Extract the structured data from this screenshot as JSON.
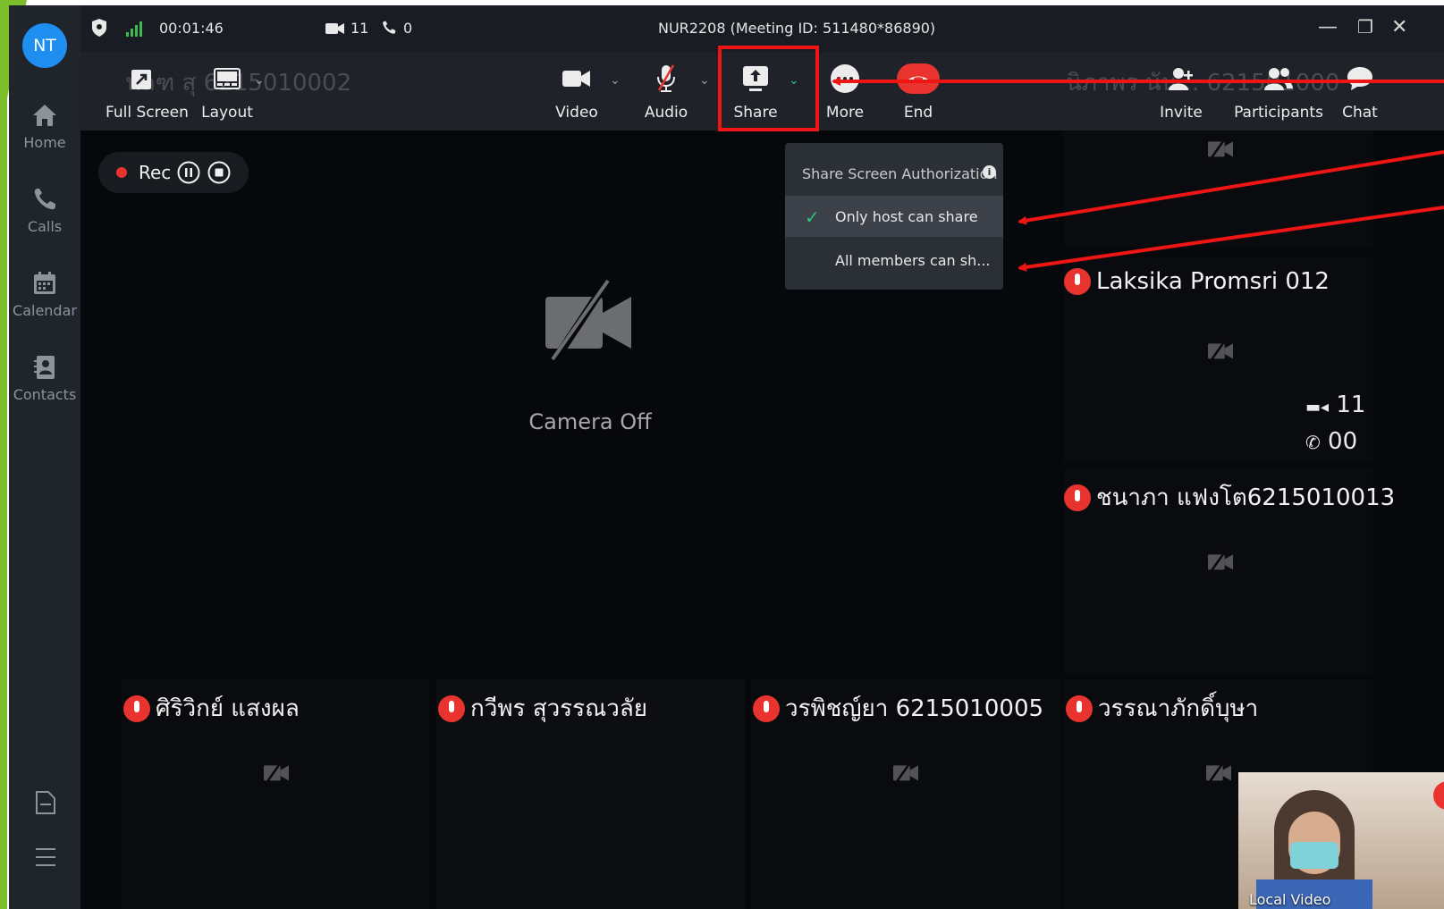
{
  "user": {
    "initials": "NT"
  },
  "sidebar": {
    "items": [
      {
        "label": "Home",
        "icon": "home-icon"
      },
      {
        "label": "Calls",
        "icon": "phone-icon"
      },
      {
        "label": "Calendar",
        "icon": "calendar-icon"
      },
      {
        "label": "Contacts",
        "icon": "contacts-icon"
      }
    ]
  },
  "titlebar": {
    "duration": "00:01:46",
    "video_count": "11",
    "phone_count": "0",
    "meeting_title": "NUR2208  (Meeting ID: 511480*86890)"
  },
  "toolbar": {
    "full_screen": "Full Screen",
    "layout": "Layout",
    "video": "Video",
    "audio": "Audio",
    "share": "Share",
    "more": "More",
    "end": "End",
    "invite": "Invite",
    "participants": "Participants",
    "chat": "Chat",
    "ghost_left": "นัลฑ สุ 6215010002",
    "ghost_right": "นิภาพร นัน... 621501000"
  },
  "share_menu": {
    "title": "Share Screen Authorization",
    "options": [
      {
        "label": "Only host can share",
        "selected": true
      },
      {
        "label": "All members can sh...",
        "selected": false
      }
    ]
  },
  "recording": {
    "label": "Rec"
  },
  "main": {
    "camera_off": "Camera Off"
  },
  "participants": [
    {
      "name": "Laksika Promsri 012"
    },
    {
      "name": "ชนาภา แฟงโต6215010013"
    },
    {
      "name": "ศิริวิกย์ แสงผล"
    },
    {
      "name": "กวีพร สุวรรณวลัย"
    },
    {
      "name": "วรพิชญ์ยา  6215010005"
    },
    {
      "name": "วรรณาภักดิ์บุษา"
    }
  ],
  "side_counts": {
    "video": "11",
    "phone": "00"
  },
  "local_video": {
    "label": "Local Video"
  },
  "colors": {
    "accent": "#1e8ef0",
    "end_red": "#e9332e",
    "highlight": "#f01515",
    "check": "#2ec27e"
  }
}
